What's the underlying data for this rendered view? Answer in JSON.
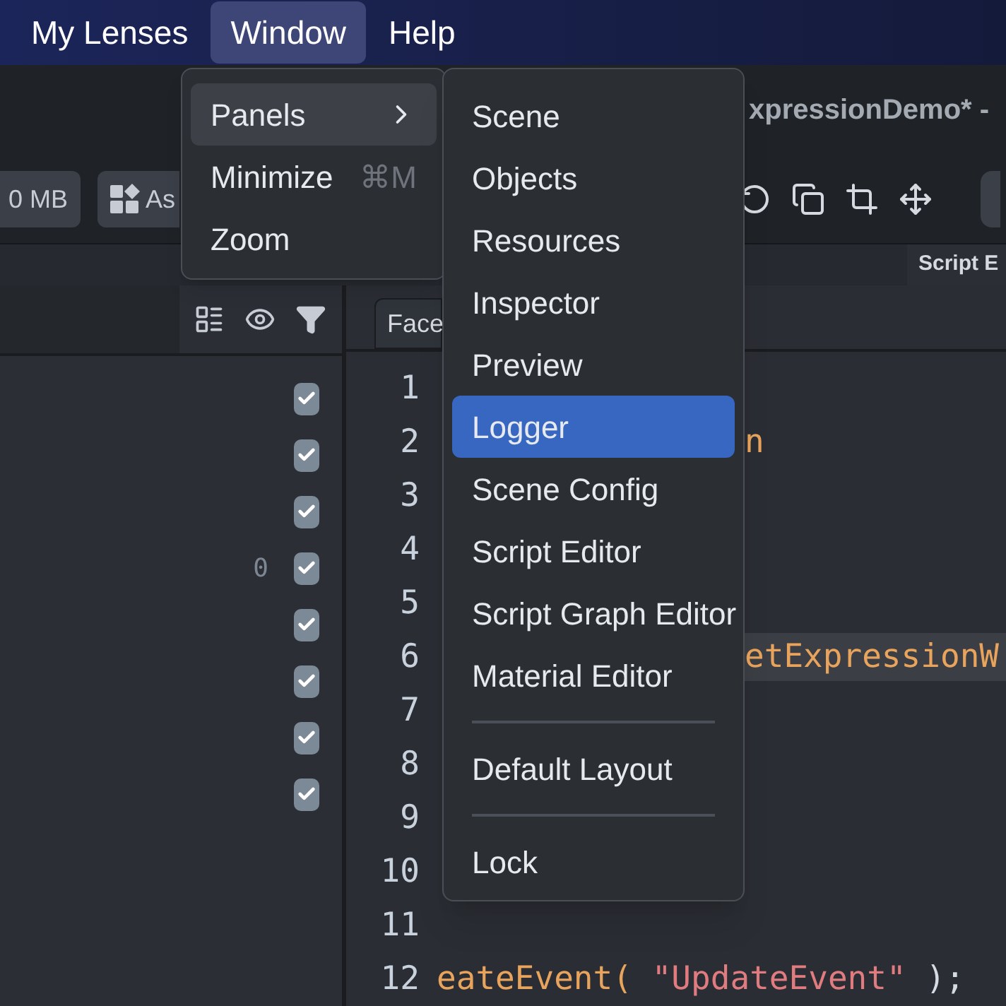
{
  "menu_bar": [
    {
      "label": "My Lenses",
      "selected": false
    },
    {
      "label": "Window",
      "selected": true
    },
    {
      "label": "Help",
      "selected": false
    }
  ],
  "window_title": "xpressionDemo* -",
  "toolbar": {
    "memory": "0 MB",
    "assets_button": "As"
  },
  "panel_tab": "Script E",
  "objects_panel": {
    "rows": [
      {
        "checked": true
      },
      {
        "checked": true
      },
      {
        "checked": true
      },
      {
        "checked": true,
        "count": "0"
      },
      {
        "checked": true
      },
      {
        "checked": true
      },
      {
        "checked": true
      },
      {
        "checked": true
      }
    ]
  },
  "editor": {
    "tab": "Face",
    "lines": [
      {
        "number": "1"
      },
      {
        "number": "2",
        "kind": "after_menu",
        "tokens": [
          {
            "kind": "function",
            "text": "n"
          }
        ]
      },
      {
        "number": "3"
      },
      {
        "number": "4"
      },
      {
        "number": "5"
      },
      {
        "number": "6",
        "kind": "highlighted",
        "tokens": [
          {
            "kind": "function",
            "text": "etExpressionW"
          }
        ]
      },
      {
        "number": "7"
      },
      {
        "number": "8"
      },
      {
        "number": "9"
      },
      {
        "number": "10"
      },
      {
        "number": "11"
      },
      {
        "number": "12",
        "kind": "plain",
        "tokens": [
          {
            "kind": "function",
            "text": "eateEvent("
          },
          {
            "kind": "string",
            "text": " \"UpdateEvent\""
          },
          {
            "kind": "plain",
            "text": " );"
          }
        ]
      }
    ]
  },
  "window_menu": {
    "items": [
      {
        "label": "Panels",
        "selected": true,
        "submenu": true
      },
      {
        "label": "Minimize",
        "selected": false,
        "shortcut": "⌘M"
      },
      {
        "label": "Zoom",
        "selected": false
      }
    ]
  },
  "panels_submenu": {
    "items": [
      {
        "label": "Scene",
        "selected": false
      },
      {
        "label": "Objects",
        "selected": false
      },
      {
        "label": "Resources",
        "selected": false
      },
      {
        "label": "Inspector",
        "selected": false
      },
      {
        "label": "Preview",
        "selected": false
      },
      {
        "label": "Logger",
        "selected": true
      },
      {
        "label": "Scene Config",
        "selected": false
      },
      {
        "label": "Script Editor",
        "selected": false
      },
      {
        "label": "Script Graph Editor",
        "selected": false
      },
      {
        "label": "Material Editor",
        "selected": false,
        "separator_after": true
      },
      {
        "label": "Default Layout",
        "selected": false,
        "separator_after": true
      },
      {
        "label": "Lock",
        "selected": false
      }
    ]
  }
}
